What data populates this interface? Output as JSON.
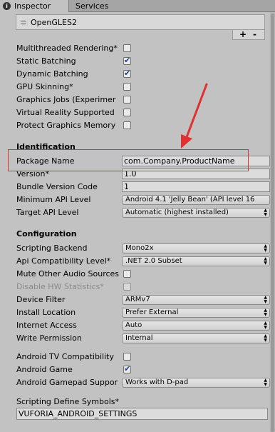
{
  "tabs": [
    {
      "label": "Inspector",
      "icon": "info-icon"
    },
    {
      "label": "Services"
    }
  ],
  "graphics_api_list": {
    "item": "OpenGLES2",
    "add_label": "+",
    "remove_label": "-"
  },
  "rendering": {
    "multithreaded_rendering": {
      "label": "Multithreaded Rendering*",
      "checked": false
    },
    "static_batching": {
      "label": "Static Batching",
      "checked": true
    },
    "dynamic_batching": {
      "label": "Dynamic Batching",
      "checked": true
    },
    "gpu_skinning": {
      "label": "GPU Skinning*",
      "checked": false
    },
    "graphics_jobs": {
      "label": "Graphics Jobs (Experimer",
      "checked": false
    },
    "virtual_reality_supported": {
      "label": "Virtual Reality Supported",
      "checked": false
    },
    "protect_graphics_memory": {
      "label": "Protect Graphics Memory",
      "checked": false
    }
  },
  "identification": {
    "title": "Identification",
    "package_name": {
      "label": "Package Name",
      "value": "com.Company.ProductName"
    },
    "version": {
      "label": "Version*",
      "value": "1.0"
    },
    "bundle_version_code": {
      "label": "Bundle Version Code",
      "value": "1"
    },
    "minimum_api_level": {
      "label": "Minimum API Level",
      "value": "Android 4.1 'Jelly Bean' (API level 16"
    },
    "target_api_level": {
      "label": "Target API Level",
      "value": "Automatic (highest installed)"
    }
  },
  "configuration": {
    "title": "Configuration",
    "scripting_backend": {
      "label": "Scripting Backend",
      "value": "Mono2x"
    },
    "api_compatibility_level": {
      "label": "Api Compatibility Level*",
      "value": ".NET 2.0 Subset"
    },
    "mute_other_audio_sources": {
      "label": "Mute Other Audio Sources",
      "checked": false
    },
    "disable_hw_statistics": {
      "label": "Disable HW Statistics*",
      "checked": false,
      "disabled": true
    },
    "device_filter": {
      "label": "Device Filter",
      "value": "ARMv7"
    },
    "install_location": {
      "label": "Install Location",
      "value": "Prefer External"
    },
    "internet_access": {
      "label": "Internet Access",
      "value": "Auto"
    },
    "write_permission": {
      "label": "Write Permission",
      "value": "Internal"
    },
    "android_tv_compatibility": {
      "label": "Android TV Compatibility",
      "checked": false
    },
    "android_game": {
      "label": "Android Game",
      "checked": true
    },
    "android_gamepad_support": {
      "label": "Android Gamepad Suppor",
      "value": "Works with D-pad"
    },
    "scripting_define_symbols": {
      "label": "Scripting Define Symbols*",
      "value": "VUFORIA_ANDROID_SETTINGS"
    }
  },
  "annotation": {
    "highlight_color": "#e03030",
    "arrow_color": "#e03030"
  },
  "colors": {
    "panel_bg": "#c2c2c2",
    "tabbar_bg": "#a5a5a5",
    "check_color": "#1d3e8a"
  }
}
